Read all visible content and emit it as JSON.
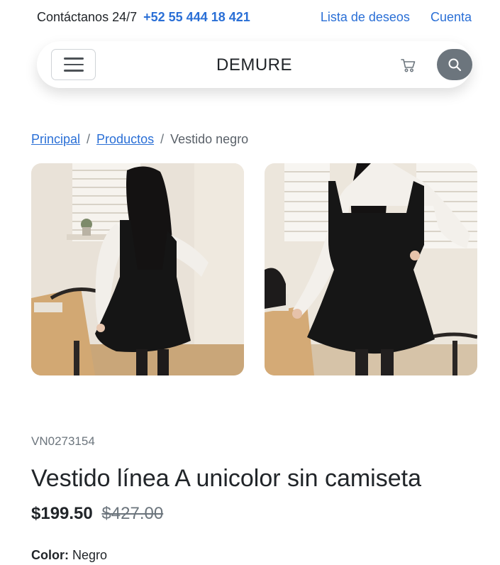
{
  "topbar": {
    "contact_label": "Contáctanos 24/7",
    "phone": "+52 55 444 18 421",
    "wishlist_label": "Lista de deseos",
    "account_label": "Cuenta"
  },
  "navbar": {
    "brand": "DEMURE",
    "menu_icon": "hamburger-menu-icon",
    "cart_icon": "cart-icon",
    "search_icon": "search-icon"
  },
  "breadcrumb": {
    "items": [
      "Principal",
      "Productos"
    ],
    "current": "Vestido negro",
    "separator": "/"
  },
  "product": {
    "sku": "VN0273154",
    "title": "Vestido línea A unicolor sin camiseta",
    "price": "$199.50",
    "old_price": "$427.00",
    "color_label": "Color:",
    "color_value": "Negro",
    "images": [
      "product-photo-back-view",
      "product-photo-front-view"
    ]
  },
  "colors": {
    "link": "#2a6fd6",
    "search_button": "#6c757d",
    "text": "#212529",
    "muted": "#6c757d"
  }
}
